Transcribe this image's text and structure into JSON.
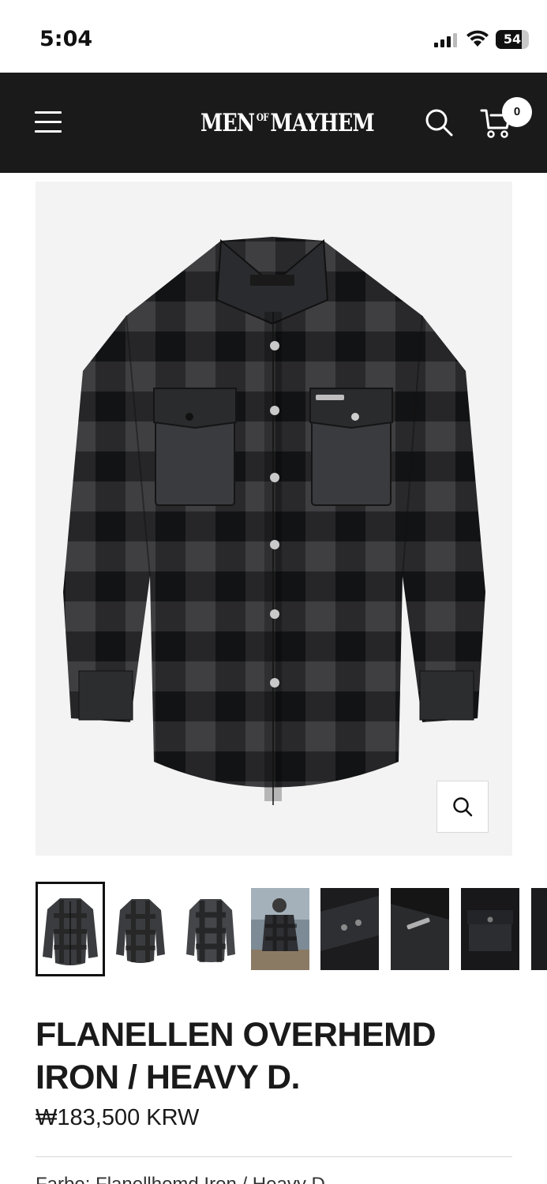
{
  "status_bar": {
    "time": "5:04",
    "battery": "54"
  },
  "header": {
    "logo": {
      "part1": "MEN",
      "part2": "OF",
      "part3": "MAYHEM"
    },
    "cart_count": "0"
  },
  "product": {
    "title_line1": "FLANELLEN OVERHEMD",
    "title_line2": "IRON / HEAVY D.",
    "price": "₩183,500 KRW",
    "variant_label": "Farbe: Flanellhemd Iron / Heavy D."
  },
  "icons": {
    "menu": "menu-icon",
    "search": "search-icon",
    "cart": "cart-icon",
    "zoom": "zoom-icon"
  },
  "colors": {
    "header_bg": "#1a1a1a",
    "image_bg": "#f3f3f3",
    "text": "#1a1a1a"
  }
}
